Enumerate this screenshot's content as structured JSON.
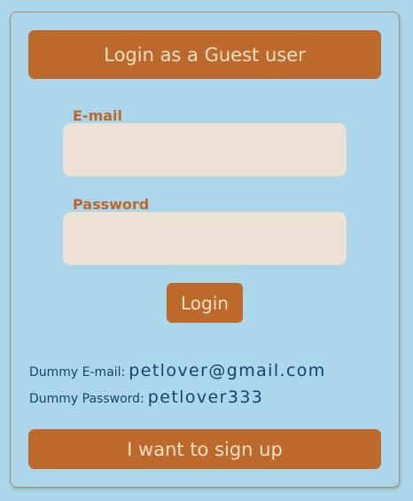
{
  "login_form": {
    "guest_button_label": "Login as a Guest user",
    "email_label": "E-mail",
    "email_value": "",
    "email_placeholder": "",
    "password_label": "Password",
    "password_value": "",
    "password_placeholder": "",
    "login_button_label": "Login"
  },
  "dummy_credentials": {
    "email_label": "Dummy E-mail:",
    "email_value": "petlover@gmail.com",
    "password_label": "Dummy Password:",
    "password_value": "petlover333"
  },
  "signup": {
    "button_label": "I want to sign up"
  },
  "colors": {
    "background": "#acd6ea",
    "accent": "#bc692b",
    "button_text": "#f7e1c5",
    "input_background": "#ede0d4",
    "dummy_text": "#18426a"
  }
}
